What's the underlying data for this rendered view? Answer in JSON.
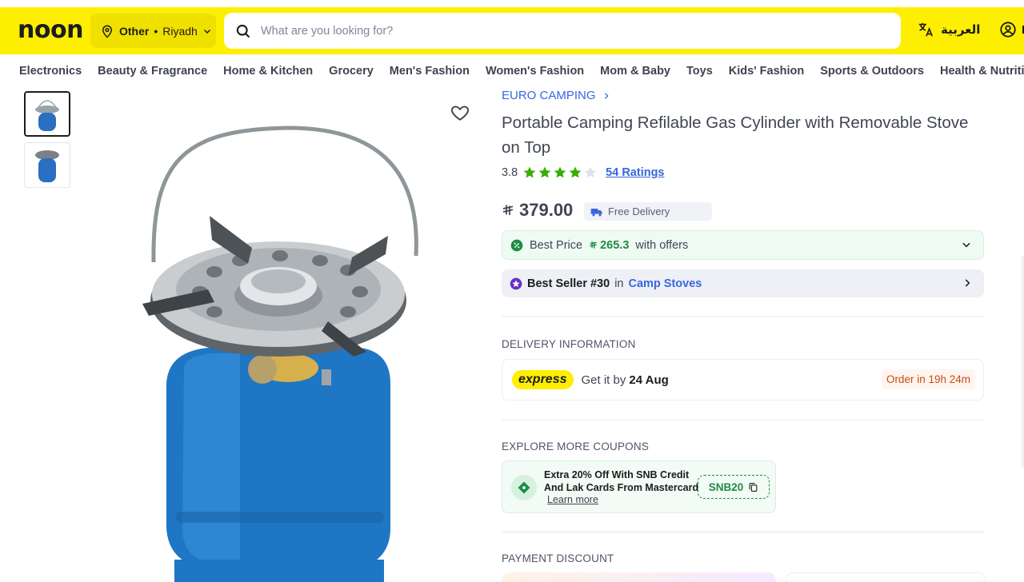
{
  "header": {
    "logo": "noon",
    "location": {
      "label": "Other",
      "city": "Riyadh"
    },
    "search": {
      "placeholder": "What are you looking for?"
    },
    "language": "العربية",
    "account_initial": "L"
  },
  "nav": {
    "items": [
      "Electronics",
      "Beauty & Fragrance",
      "Home & Kitchen",
      "Grocery",
      "Men's Fashion",
      "Women's Fashion",
      "Mom & Baby",
      "Toys",
      "Kids' Fashion",
      "Sports & Outdoors",
      "Health & Nutrition"
    ]
  },
  "product": {
    "brand": "EURO CAMPING",
    "title": "Portable Camping Refilable Gas Cylinder with Removable Stove on Top",
    "rating": "3.8",
    "rating_stars": 3.8,
    "ratings_count": "54 Ratings",
    "currency_symbol": "⃁",
    "price": "379.00",
    "free_delivery": "Free Delivery"
  },
  "offers": {
    "best_price_prefix": "Best Price",
    "best_price_value": "265.3",
    "best_price_suffix": "with offers",
    "best_seller_label": "Best Seller #30",
    "best_seller_in": "in",
    "best_seller_category": "Camp Stoves"
  },
  "delivery": {
    "section_title": "DELIVERY INFORMATION",
    "badge": "express",
    "get_it_by": "Get it by",
    "date": "24 Aug",
    "order_within": "Order in 19h 24m"
  },
  "coupons": {
    "section_title": "EXPLORE MORE COUPONS",
    "text": "Extra 20% Off With SNB Credit And Lak Cards From Mastercard",
    "learn_more": "Learn more",
    "code": "SNB20"
  },
  "payment": {
    "section_title": "PAYMENT DISCOUNT"
  },
  "colors": {
    "brand_yellow": "#feee00",
    "link_blue": "#3866df",
    "green": "#1f8b45",
    "star_green": "#38ae04"
  }
}
